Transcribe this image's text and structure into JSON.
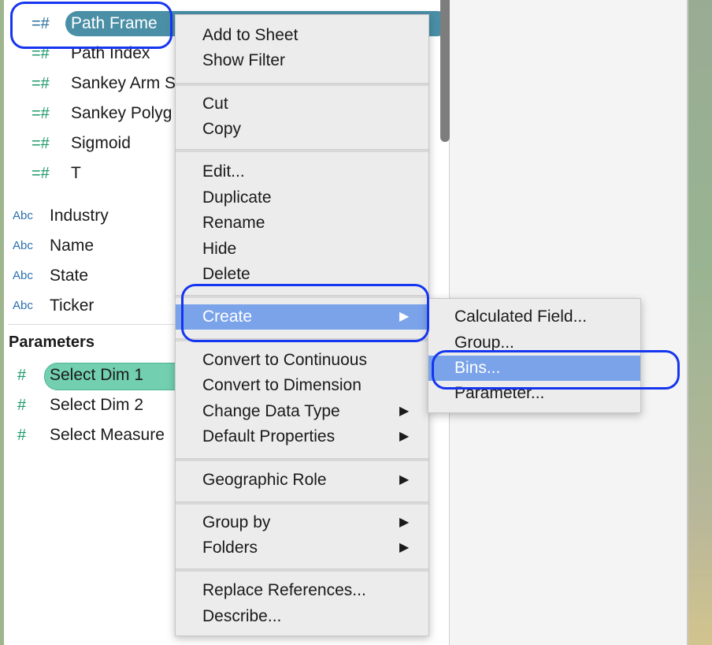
{
  "fields": [
    {
      "label": "Path Frame",
      "icon": "measure-hash-icon",
      "selected": true
    },
    {
      "label": "Path Index",
      "icon": "measure-hash-icon"
    },
    {
      "label": "Sankey Arm S",
      "icon": "measure-hash-icon"
    },
    {
      "label": "Sankey Polyg",
      "icon": "measure-hash-icon"
    },
    {
      "label": "Sigmoid",
      "icon": "measure-hash-icon"
    },
    {
      "label": "T",
      "icon": "measure-hash-icon"
    }
  ],
  "dimensions": [
    {
      "label": "Industry",
      "icon_text": "Abc"
    },
    {
      "label": "Name",
      "icon_text": "Abc"
    },
    {
      "label": "State",
      "icon_text": "Abc"
    },
    {
      "label": "Ticker",
      "icon_text": "Abc"
    }
  ],
  "parameters": {
    "heading": "Parameters",
    "items": [
      {
        "label": "Select Dim 1",
        "selected": true
      },
      {
        "label": "Select Dim 2"
      },
      {
        "label": "Select Measure"
      }
    ]
  },
  "icons": {
    "measure": "=#",
    "param": "#"
  },
  "context_menu": {
    "items": [
      "Add to Sheet",
      "Show Filter",
      "Cut",
      "Copy",
      "Edit...",
      "Duplicate",
      "Rename",
      "Hide",
      "Delete",
      "Create",
      "Convert to Continuous",
      "Convert to Dimension",
      "Change Data Type",
      "Default Properties",
      "Geographic Role",
      "Group by",
      "Folders",
      "Replace References...",
      "Describe..."
    ],
    "highlighted": "Create",
    "arrow": "▶"
  },
  "submenu": {
    "items": [
      "Calculated Field...",
      "Group...",
      "Bins...",
      "Parameter..."
    ],
    "highlighted": "Bins..."
  },
  "colors": {
    "highlight": "#7aa3ea",
    "annotation": "#1535f0",
    "selected_field": "#4a8fa6",
    "selected_param": "#72d0b0"
  }
}
